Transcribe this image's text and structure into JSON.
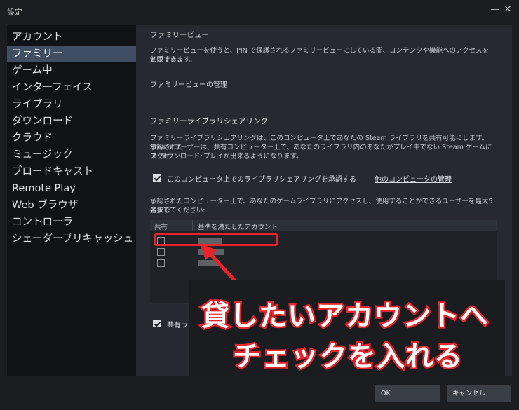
{
  "window": {
    "title": "設定",
    "minimize_icon": "minimize-icon",
    "close_icon": "close-icon"
  },
  "sidebar": {
    "items": [
      {
        "label": "アカウント",
        "active": false
      },
      {
        "label": "ファミリー",
        "active": true
      },
      {
        "label": "ゲーム中",
        "active": false
      },
      {
        "label": "インターフェイス",
        "active": false
      },
      {
        "label": "ライブラリ",
        "active": false
      },
      {
        "label": "ダウンロード",
        "active": false
      },
      {
        "label": "クラウド",
        "active": false
      },
      {
        "label": "ミュージック",
        "active": false
      },
      {
        "label": "ブロードキャスト",
        "active": false
      },
      {
        "label": "Remote Play",
        "active": false
      },
      {
        "label": "Web ブラウザ",
        "active": false
      },
      {
        "label": "コントローラ",
        "active": false
      },
      {
        "label": "シェーダープリキャッシュ",
        "active": false
      }
    ]
  },
  "family_view": {
    "title": "ファミリービュー",
    "desc_line1": "ファミリービューを使うと、PIN で保護されるファミリービューにしている間、コンテンツや機能へのアクセスを制限するこ",
    "desc_line2": "とができます。",
    "manage_link": "ファミリービューの管理"
  },
  "library_sharing": {
    "title": "ファミリーライブラリシェアリング",
    "desc_line1": "ファミリーライブラリシェアリングは、このコンピュータ上であなたの Steam ライブラリを共有可能にします。承認された",
    "desc_line2": "Steam ユーザーは、共有コンピューター上で、あなたのライブラリ内のあなたがプレイ中でない Steam ゲームにアクセ",
    "desc_line3": "ス･ダウンロード･プレイが出来るようになります。",
    "authorize_label": "このコンピュータ上でのライブラリシェアリングを承認する",
    "authorize_checked": true,
    "other_computers_link": "他のコンピュータの管理",
    "accounts_desc_line1": "承認されたコンピューター上で、あなたのゲームライブラリにアクセスし、使用することができるユーザーを最大5名まで",
    "accounts_desc_line2": "選択してください:",
    "table": {
      "headers": [
        "共有",
        "基準を満たしたアカウント"
      ],
      "rows": [
        {
          "checked": false
        },
        {
          "checked": false
        },
        {
          "checked": false
        }
      ]
    },
    "notify_label_partial": "共有ラ",
    "notify_checked": true
  },
  "buttons": {
    "ok": "OK",
    "cancel": "キャンセル"
  },
  "annotation": {
    "line1": "貸したいアカウントへ",
    "line2": "チェックを入れる",
    "color": "#e8242a"
  }
}
